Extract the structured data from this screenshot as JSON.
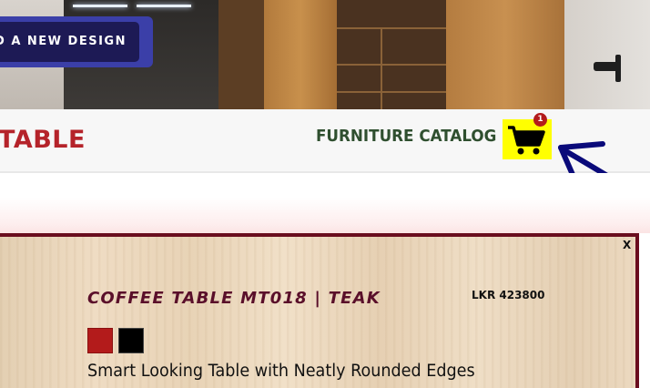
{
  "hero": {
    "design_button_label": "D A NEW DESIGN"
  },
  "header": {
    "logo_text": "TABLE",
    "catalog_link": "FURNITURE CATALOG",
    "cart_icon": "shopping-cart-icon",
    "cart_count": "1"
  },
  "product": {
    "close_label": "X",
    "title": "COFFEE TABLE MT018 | TEAK",
    "price": "LKR 423800",
    "color_swatches": [
      "#b31b1b",
      "#000000"
    ],
    "description": "Smart Looking Table with Neatly Rounded Edges"
  },
  "colors": {
    "brand_red": "#b5232a",
    "catalog_green": "#2f4f2f",
    "cart_highlight": "#ffff00",
    "panel_border": "#6a0d1e",
    "annotation_arrow": "#0a0a7a"
  }
}
